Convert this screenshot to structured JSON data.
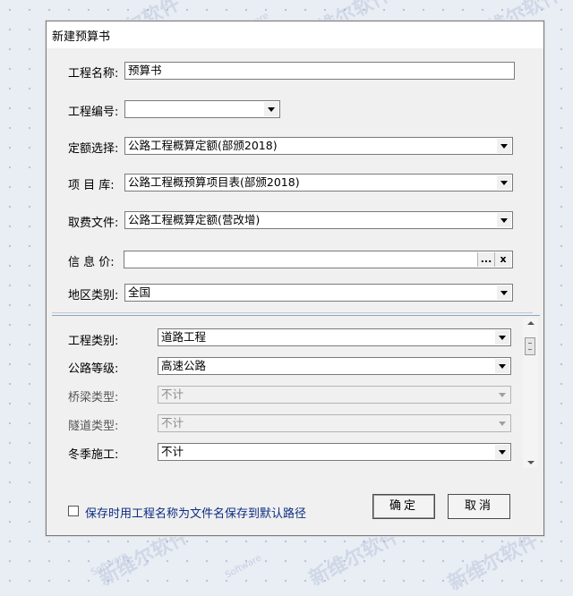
{
  "watermark": {
    "cn": "新维尔软件",
    "en": "Software"
  },
  "dialog": {
    "title": "新建预算书",
    "fields": {
      "project_name": {
        "label": "工程名称:",
        "value": "预算书"
      },
      "project_number": {
        "label": "工程编号:",
        "value": ""
      },
      "quota": {
        "label": "定额选择:",
        "value": "公路工程概算定额(部颁2018)"
      },
      "item_lib": {
        "label": "项 目 库:",
        "value": "公路工程概预算项目表(部颁2018)"
      },
      "fee_file": {
        "label": "取费文件:",
        "value": "公路工程概算定额(营改增)"
      },
      "info_price": {
        "label": "信 息 价:",
        "value": "",
        "browse": "...",
        "clear": "x"
      },
      "region": {
        "label": "地区类别:",
        "value": "全国"
      }
    },
    "params": [
      {
        "label": "工程类别:",
        "value": "道路工程",
        "enabled": true
      },
      {
        "label": "公路等级:",
        "value": "高速公路",
        "enabled": true
      },
      {
        "label": "桥梁类型:",
        "value": "不计",
        "enabled": false
      },
      {
        "label": "隧道类型:",
        "value": "不计",
        "enabled": false
      },
      {
        "label": "冬季施工:",
        "value": "不计",
        "enabled": true
      }
    ],
    "save_default_label": "保存时用工程名称为文件名保存到默认路径",
    "save_default_checked": false,
    "ok_label": "确定",
    "cancel_label": "取消"
  }
}
